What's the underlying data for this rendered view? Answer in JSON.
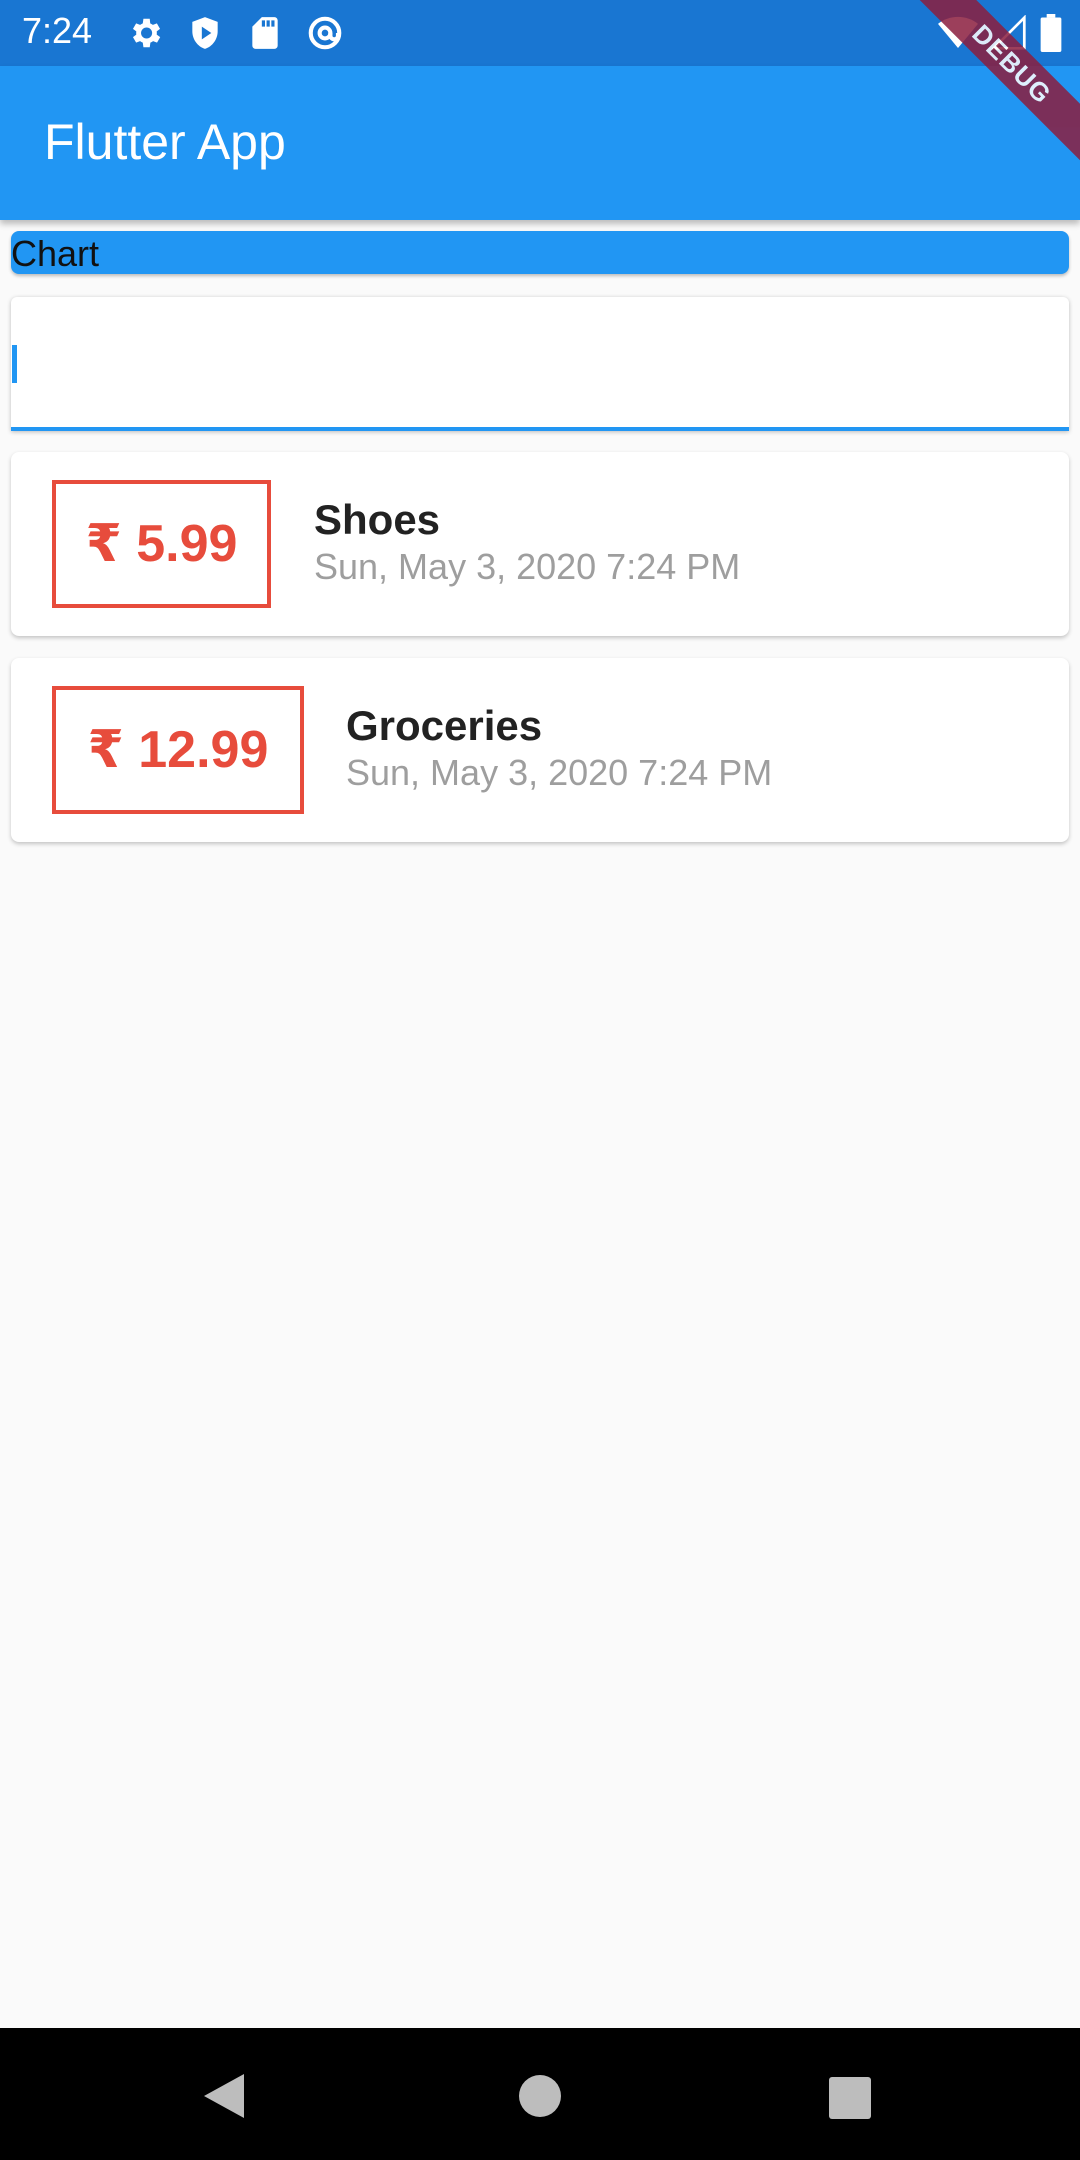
{
  "status_bar": {
    "time": "7:24",
    "icons_left": [
      "settings-icon",
      "shield-play-icon",
      "sd-card-icon",
      "at-sign-icon"
    ],
    "icons_right": [
      "wifi-icon",
      "cellular-icon",
      "battery-icon"
    ],
    "background": "#1976d2"
  },
  "debug_banner": {
    "label": "DEBUG"
  },
  "app_bar": {
    "title": "Flutter App",
    "background": "#2196f3"
  },
  "chart": {
    "label": "Chart"
  },
  "input": {
    "value": "",
    "placeholder": ""
  },
  "transactions": [
    {
      "amount": "₹ 5.99",
      "title": "Shoes",
      "date": "Sun, May 3, 2020 7:24 PM"
    },
    {
      "amount": "₹ 12.99",
      "title": "Groceries",
      "date": "Sun, May 3, 2020 7:24 PM"
    }
  ],
  "colors": {
    "amount": "#e74c3c",
    "date": "#9e9e9e",
    "accent": "#2196f3"
  },
  "nav_bar": {
    "buttons": [
      "back-icon",
      "home-icon",
      "recents-icon"
    ]
  }
}
